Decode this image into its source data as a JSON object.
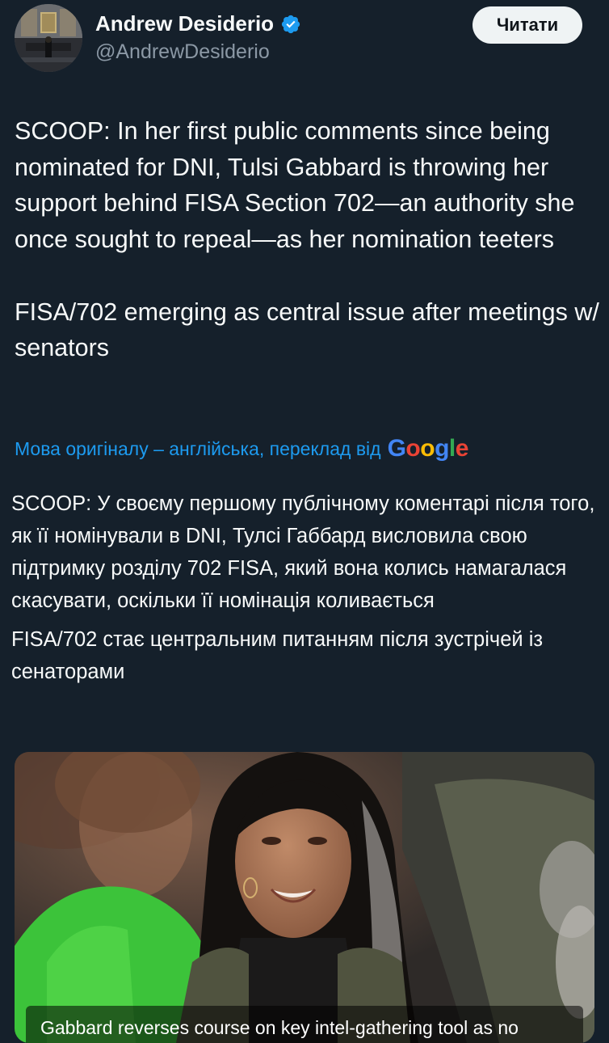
{
  "author": {
    "name": "Andrew Desiderio",
    "handle": "@AndrewDesiderio",
    "verified_icon": "verified-badge-icon"
  },
  "follow_button": {
    "label": "Читати"
  },
  "tweet": {
    "paragraphs": [
      "SCOOP: In her first public comments since being nominated for DNI, Tulsi Gabbard is throwing her support behind FISA Section 702—an authority she once sought to repeal—as her nomination teeters",
      "FISA/702 emerging as central issue after meetings w/ senators"
    ]
  },
  "translation": {
    "notice": "Мова оригіналу – англійська, переклад від",
    "provider_letters": [
      "G",
      "o",
      "o",
      "g",
      "l",
      "e"
    ],
    "paragraphs": [
      "SCOOP: У своєму першому публічному коментарі після того, як її номінували в DNI, Тулсі Габбард висловила свою підтримку розділу 702 FISA, який вона колись намагалася скасувати, оскільки її номінація коливається",
      "FISA/702 стає центральним питанням після зустрічей із сенаторами"
    ]
  },
  "link_card": {
    "caption": "Gabbard reverses course on key intel-gathering tool as no"
  },
  "colors": {
    "background": "#15202b",
    "text": "#f7f9f9",
    "secondary_text": "#8b98a5",
    "link": "#1d9bf0",
    "verified": "#1d9bf0",
    "button_bg": "#eff3f4"
  }
}
